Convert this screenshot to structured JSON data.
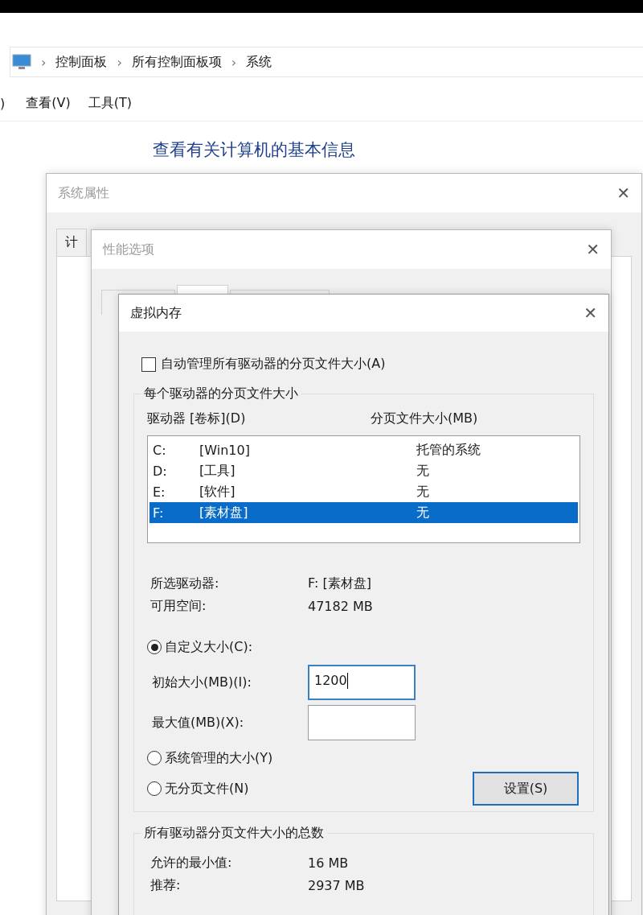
{
  "explorer": {
    "breadcrumb": [
      "控制面板",
      "所有控制面板项",
      "系统"
    ],
    "separator": "›",
    "menu": [
      ")",
      "查看(V)",
      "工具(T)"
    ],
    "heading": "查看有关计算机的基本信息"
  },
  "system_properties": {
    "title": "系统属性",
    "close": "✕",
    "tabs": [
      {
        "label": "计",
        "selected": false
      }
    ]
  },
  "performance_options": {
    "title": "性能选项",
    "close": "✕",
    "tabs": [
      {
        "selected": false
      },
      {
        "selected": true
      },
      {
        "selected": false
      }
    ]
  },
  "virtual_memory": {
    "title": "虚拟内存",
    "close": "✕",
    "auto_manage": {
      "label": "自动管理所有驱动器的分页文件大小(A)",
      "checked": false
    },
    "per_drive": {
      "title": "每个驱动器的分页文件大小",
      "columns": [
        "驱动器 [卷标](D)",
        "分页文件大小(MB)"
      ],
      "drives": [
        {
          "letter": "C:",
          "volume": "[Win10]",
          "size": "托管的系统",
          "selected": false
        },
        {
          "letter": "D:",
          "volume": "[工具]",
          "size": "无",
          "selected": false
        },
        {
          "letter": "E:",
          "volume": "[软件]",
          "size": "无",
          "selected": false
        },
        {
          "letter": "F:",
          "volume": "[素材盘]",
          "size": "无",
          "selected": true
        }
      ],
      "info": [
        {
          "label": "所选驱动器:",
          "value": "F:  [素材盘]"
        },
        {
          "label": "可用空间:",
          "value": "47182 MB"
        }
      ],
      "options": [
        {
          "kind": "radio",
          "label": "自定义大小(C):",
          "selected": true
        },
        {
          "kind": "field",
          "label": "初始大小(MB)(I):",
          "value": "1200",
          "focused": true
        },
        {
          "kind": "field",
          "label": "最大值(MB)(X):",
          "focused": false
        },
        {
          "kind": "radio",
          "label": "系统管理的大小(Y)",
          "selected": false
        },
        {
          "kind": "radio",
          "label": "无分页文件(N)",
          "selected": false,
          "button": "设置(S)"
        }
      ]
    },
    "totals": {
      "title": "所有驱动器分页文件大小的总数",
      "rows": [
        {
          "label": "允许的最小值:",
          "value": "16 MB"
        },
        {
          "label": "推荐:",
          "value": "2937 MB"
        }
      ]
    }
  }
}
